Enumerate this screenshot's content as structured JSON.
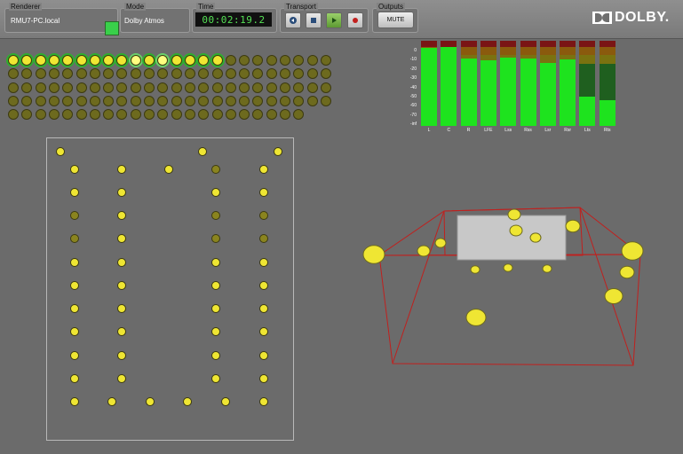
{
  "toolbar": {
    "renderer": {
      "label": "Renderer",
      "value": "RMU7-PC.local",
      "status_color": "#39d04a"
    },
    "mode": {
      "label": "Mode",
      "value": "Dolby Atmos"
    },
    "time": {
      "label": "Time",
      "value": "00:02:19.2"
    },
    "transport": {
      "label": "Transport",
      "buttons": [
        "rewind-icon",
        "stop-icon",
        "play-icon",
        "record-icon"
      ]
    },
    "outputs": {
      "label": "Outputs",
      "mute_label": "MUTE"
    },
    "brand": "DOLBY."
  },
  "objects": {
    "rows": [
      {
        "count": 24,
        "states": [
          "on",
          "on",
          "on",
          "on",
          "on",
          "on",
          "on",
          "on",
          "on",
          "lit",
          "on",
          "lit",
          "on",
          "on",
          "on",
          "on",
          "off",
          "off",
          "off",
          "off",
          "off",
          "off",
          "off",
          "off"
        ]
      },
      {
        "count": 24
      },
      {
        "count": 24
      },
      {
        "count": 24
      },
      {
        "count": 22
      }
    ]
  },
  "meters": {
    "scale": [
      "0",
      "-10",
      "-20",
      "-30",
      "-40",
      "-50",
      "-60",
      "-70",
      "-inf"
    ],
    "channels": [
      {
        "name": "L",
        "level": 0.92
      },
      {
        "name": "C",
        "level": 0.93
      },
      {
        "name": "R",
        "level": 0.79
      },
      {
        "name": "LFE",
        "level": 0.77
      },
      {
        "name": "Lss",
        "level": 0.8
      },
      {
        "name": "Rss",
        "level": 0.79
      },
      {
        "name": "Lsr",
        "level": 0.74
      },
      {
        "name": "Rsr",
        "level": 0.78
      },
      {
        "name": "Lts",
        "level": 0.34
      },
      {
        "name": "Rts",
        "level": 0.3
      }
    ]
  },
  "colors": {
    "accent": "#efe633",
    "meter_green": "#1ee31e",
    "room_box": "#c0201e"
  }
}
